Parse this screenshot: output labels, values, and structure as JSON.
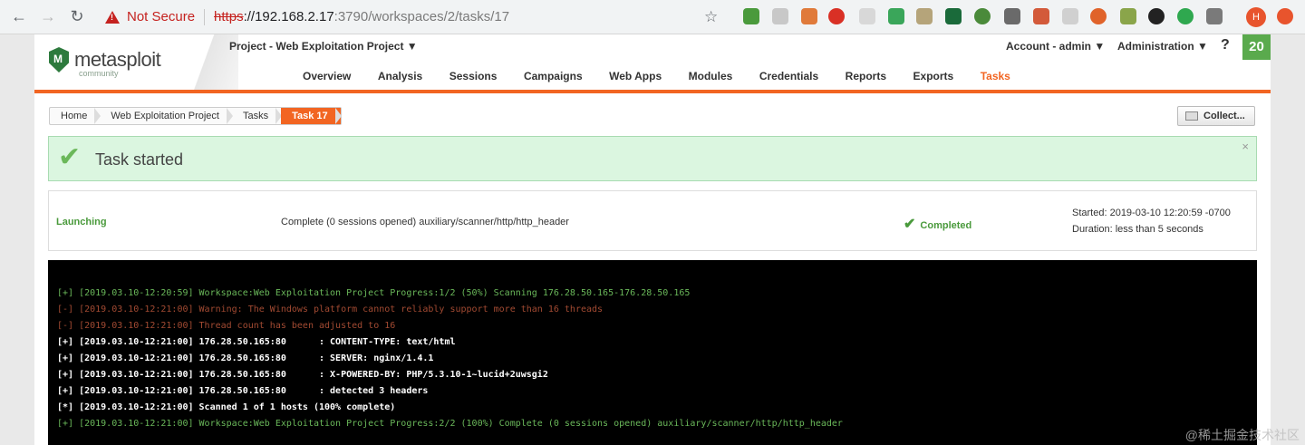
{
  "browser": {
    "security_label": "Not Secure",
    "url_protocol": "https",
    "url_host": "://192.168.2.17",
    "url_rest": ":3790/workspaces/2/tasks/17",
    "avatar_letter": "H"
  },
  "app": {
    "logo_text": "metasploit",
    "logo_sub": "community",
    "project_menu": "Project - Web Exploitation Project ▼",
    "account_menu": "Account - admin ▼",
    "admin_menu": "Administration ▼",
    "help": "?",
    "notification_count": "20",
    "tabs": [
      {
        "label": "Overview"
      },
      {
        "label": "Analysis"
      },
      {
        "label": "Sessions"
      },
      {
        "label": "Campaigns"
      },
      {
        "label": "Web Apps"
      },
      {
        "label": "Modules"
      },
      {
        "label": "Credentials"
      },
      {
        "label": "Reports"
      },
      {
        "label": "Exports"
      },
      {
        "label": "Tasks"
      }
    ],
    "active_tab": "Tasks"
  },
  "breadcrumb": [
    "Home",
    "Web Exploitation Project",
    "Tasks",
    "Task 17"
  ],
  "collect_button": "Collect...",
  "flash": {
    "message": "Task started",
    "close": "×"
  },
  "task": {
    "phase": "Launching",
    "description": "Complete (0 sessions opened) auxiliary/scanner/http/http_header",
    "status": "Completed",
    "started": "Started: 2019-03-10 12:20:59 -0700",
    "duration": "Duration: less than 5 seconds"
  },
  "console_lines": [
    {
      "text": "[+] [2019.03.10-12:20:59] Workspace:Web Exploitation Project Progress:1/2 (50%) Scanning 176.28.50.165-176.28.50.165",
      "style": "green"
    },
    {
      "text": "[-] [2019.03.10-12:21:00] Warning: The Windows platform cannot reliably support more than 16 threads",
      "style": "red"
    },
    {
      "text": "[-] [2019.03.10-12:21:00] Thread count has been adjusted to 16",
      "style": "red"
    },
    {
      "text": "[+] [2019.03.10-12:21:00] 176.28.50.165:80      : CONTENT-TYPE: text/html",
      "style": "white"
    },
    {
      "text": "[+] [2019.03.10-12:21:00] 176.28.50.165:80      : SERVER: nginx/1.4.1",
      "style": "white"
    },
    {
      "text": "[+] [2019.03.10-12:21:00] 176.28.50.165:80      : X-POWERED-BY: PHP/5.3.10-1~lucid+2uwsgi2",
      "style": "white"
    },
    {
      "text": "[+] [2019.03.10-12:21:00] 176.28.50.165:80      : detected 3 headers",
      "style": "white"
    },
    {
      "text": "[*] [2019.03.10-12:21:00] Scanned 1 of 1 hosts (100% complete)",
      "style": "white"
    },
    {
      "text": "[+] [2019.03.10-12:21:00] Workspace:Web Exploitation Project Progress:2/2 (100%) Complete (0 sessions opened) auxiliary/scanner/http/http_header",
      "style": "green"
    }
  ],
  "watermark": "@稀土掘金技术社区"
}
